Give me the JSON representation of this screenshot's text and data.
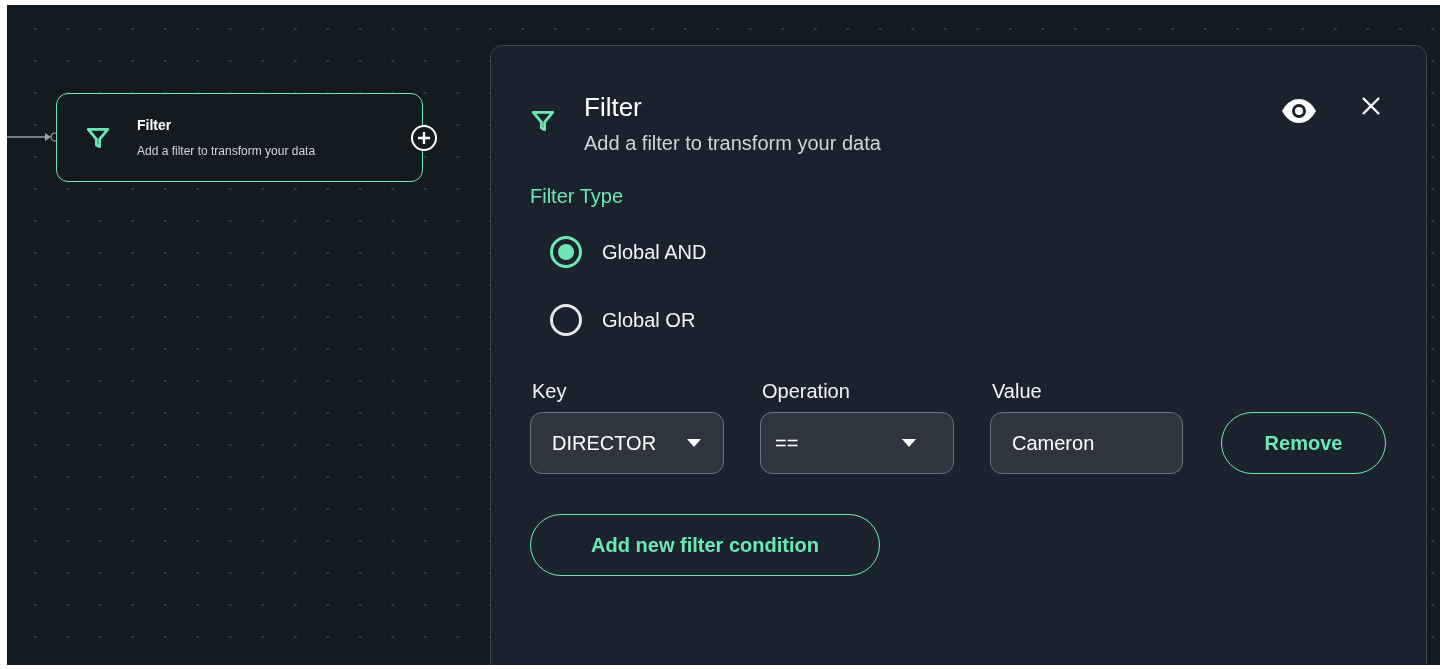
{
  "node": {
    "title": "Filter",
    "subtitle": "Add a filter to transform your data",
    "selected": true
  },
  "panel": {
    "title": "Filter",
    "subtitle": "Add a filter to transform your data",
    "filter_type_label": "Filter Type",
    "filter_types": [
      {
        "label": "Global AND",
        "selected": true
      },
      {
        "label": "Global OR",
        "selected": false
      }
    ],
    "conditions": [
      {
        "key_label": "Key",
        "key": "DIRECTOR",
        "operation_label": "Operation",
        "operation": "==",
        "value_label": "Value",
        "value": "Cameron",
        "remove": "Remove"
      }
    ],
    "add_button": "Add new filter condition"
  }
}
